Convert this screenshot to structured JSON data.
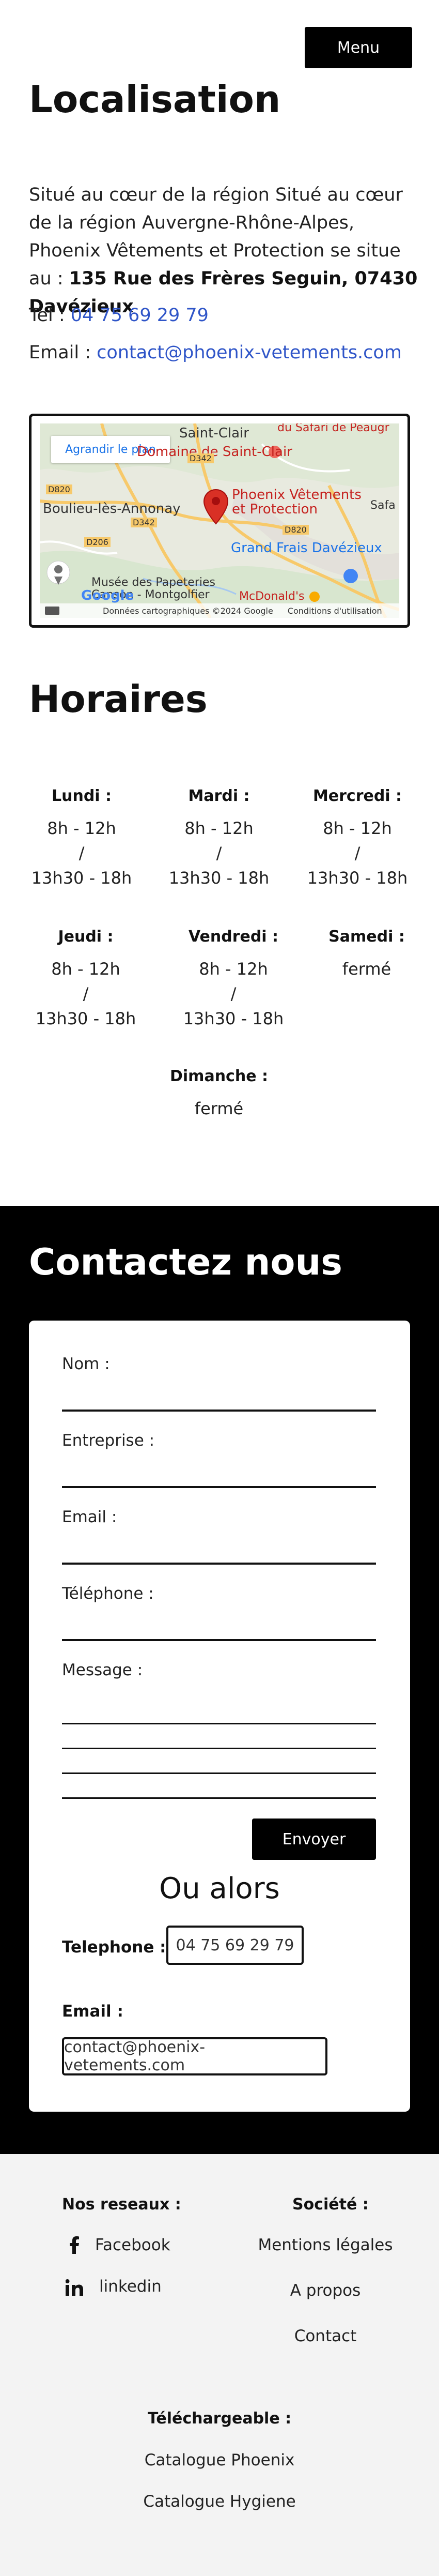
{
  "header": {
    "menu_label": "Menu"
  },
  "localisation": {
    "title": "Localisation",
    "intro": "Situé au cœur de la région Situé au cœur de la région Auvergne-Rhône-Alpes, Phoenix Vêtements et Protection se situe au : ",
    "address": "135 Rue des Frères Seguin, 07430 Davézieux",
    "phone_label": "Tel : ",
    "phone": "04 75 69 29 79",
    "email_label": "Email : ",
    "email": "contact@phoenix-vetements.com"
  },
  "map": {
    "enlarge_label": "Agrandir le plan",
    "labels": {
      "saint_clair": "Saint-Clair",
      "domaine": "Domaine de Saint-Clair",
      "phoenix": "Phoenix Vêtements\net Protection",
      "boulieu": "Boulieu-lès-Annonay",
      "grand_frais": "Grand Frais Davézieux",
      "musee": "Musée des Papeteries\nCanson - Montgolfier",
      "mcdonalds": "McDonald's",
      "safari": "du Safari de Peaugr",
      "saf": "Safa",
      "d342_a": "D342",
      "d342_b": "D342",
      "d820_a": "D820",
      "d820_b": "D820",
      "d206": "D206"
    },
    "google": "Google",
    "attribution_data": "Données cartographiques ©2024 Google",
    "attribution_terms": "Conditions d'utilisation"
  },
  "horaires": {
    "title": "Horaires",
    "days": [
      {
        "name": "Lundi :",
        "line1": "8h - 12h",
        "sep": "/",
        "line2": "13h30 - 18h"
      },
      {
        "name": "Mardi :",
        "line1": "8h - 12h",
        "sep": "/",
        "line2": "13h30 - 18h"
      },
      {
        "name": "Mercredi :",
        "line1": "8h - 12h",
        "sep": "/",
        "line2": "13h30 - 18h"
      },
      {
        "name": "Jeudi :",
        "line1": "8h - 12h",
        "sep": "/",
        "line2": "13h30 - 18h"
      },
      {
        "name": "Vendredi :",
        "line1": "8h - 12h",
        "sep": "/",
        "line2": "13h30 - 18h"
      },
      {
        "name": "Samedi :",
        "line1": "fermé"
      },
      {
        "name": "Dimanche :",
        "line1": "fermé"
      }
    ]
  },
  "contact": {
    "title": "Contactez nous",
    "fields": {
      "nom": "Nom :",
      "entreprise": "Entreprise :",
      "email": "Email :",
      "telephone": "Téléphone :",
      "message": "Message :"
    },
    "send_label": "Envoyer",
    "or_label": "Ou alors",
    "phone_label": "Telephone :",
    "phone_value": "04 75 69 29 79",
    "email_label": "Email :",
    "email_value": "contact@phoenix-vetements.com"
  },
  "footer": {
    "social_heading": "Nos reseaux :",
    "social": [
      {
        "label": "Facebook",
        "icon": "facebook-icon"
      },
      {
        "label": "linkedin",
        "icon": "linkedin-icon"
      }
    ],
    "company_heading": "Société :",
    "company_links": [
      "Mentions légales",
      "A propos",
      "Contact"
    ],
    "download_heading": "Téléchargeable :",
    "downloads": [
      "Catalogue Phoenix",
      "Catalogue Hygiene"
    ]
  },
  "colors": {
    "link": "#2f55c8",
    "black": "#000000",
    "footer_bg": "#f3f3f3",
    "map_pin": "#d93025"
  }
}
